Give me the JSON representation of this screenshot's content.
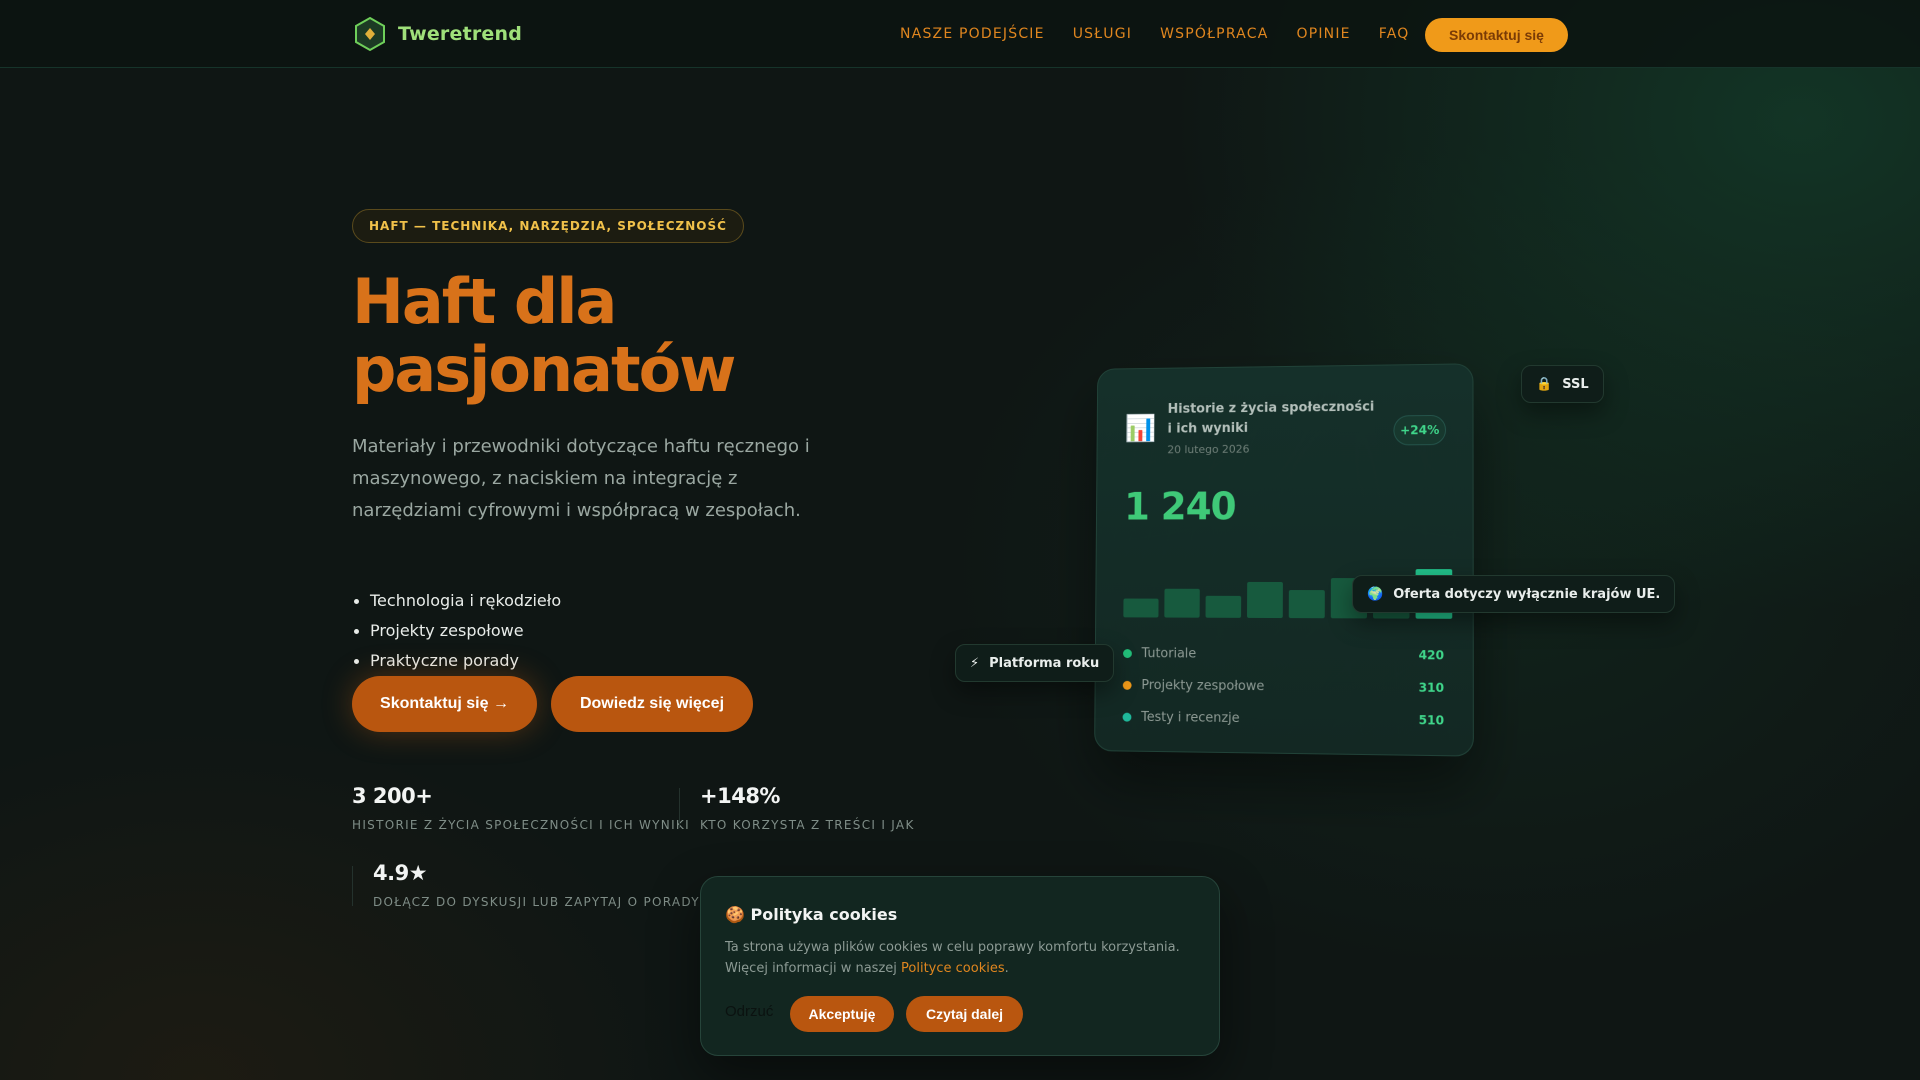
{
  "brand": {
    "name": "Tweretrend",
    "logo_icon": "hexagon-diamond-icon",
    "accent": "#9fe07a"
  },
  "nav": {
    "links": [
      "NASZE PODEJŚCIE",
      "USŁUGI",
      "WSPÓŁPRACA",
      "OPINIE",
      "FAQ"
    ],
    "cta": "Skontaktuj się"
  },
  "hero": {
    "pill": "HAFT — TECHNIKA, NARZĘDZIA, SPOŁECZNOŚĆ",
    "title_line1": "Haft dla",
    "title_line2": "pasjonatów",
    "lead": "Materiały i przewodniki dotyczące haftu ręcznego i maszynowego, z naciskiem na integrację z narzędziami cyfrowymi i współpracą w zespołach.",
    "bullets": [
      "Technologia i rękodzieło",
      "Projekty zespołowe",
      "Praktyczne porady"
    ],
    "btn_primary": "Skontaktuj się →",
    "btn_secondary": "Dowiedz się więcej"
  },
  "stats": [
    {
      "value": "3 200+",
      "label": "HISTORIE Z ŻYCIA SPOŁECZNOŚCI I ICH WYNIKI"
    },
    {
      "value": "+148%",
      "label": "KTO KORZYSTA Z TREŚCI I JAK"
    },
    {
      "value": "4.9★",
      "label": "DOŁĄCZ DO DYSKUSJI LUB ZAPYTAJ O PORADY"
    }
  ],
  "card": {
    "icon": "bar-chart-icon",
    "title": "Historie z życia społeczności i ich wyniki",
    "date": "20 lutego 2026",
    "badge": "+24%",
    "big_value": "1 240",
    "bars": [
      0.32,
      0.48,
      0.36,
      0.6,
      0.46,
      0.66,
      0.54,
      0.82
    ],
    "legend": [
      {
        "label": "Tutoriale",
        "value": "420",
        "color": "#22c07a"
      },
      {
        "label": "Projekty zespołowe",
        "value": "310",
        "color": "#f09a19"
      },
      {
        "label": "Testy i recenzje",
        "value": "510",
        "color": "#1fb89a"
      }
    ]
  },
  "chips": {
    "ssl": {
      "icon": "lock-icon",
      "label": "SSL"
    },
    "eu": {
      "icon": "globe-icon",
      "label": "Oferta dotyczy wyłącznie krajów UE."
    },
    "platform": {
      "icon": "lightning-icon",
      "label": "Platforma roku"
    }
  },
  "cookie": {
    "title": "🍪 Polityka cookies",
    "text_before": "Ta strona używa plików cookies w celu poprawy komfortu korzystania. Więcej informacji w naszej ",
    "link": "Polityce cookies",
    "text_after": ".",
    "reject": "Odrzuć",
    "accept": "Akceptuję",
    "more": "Czytaj dalej"
  }
}
